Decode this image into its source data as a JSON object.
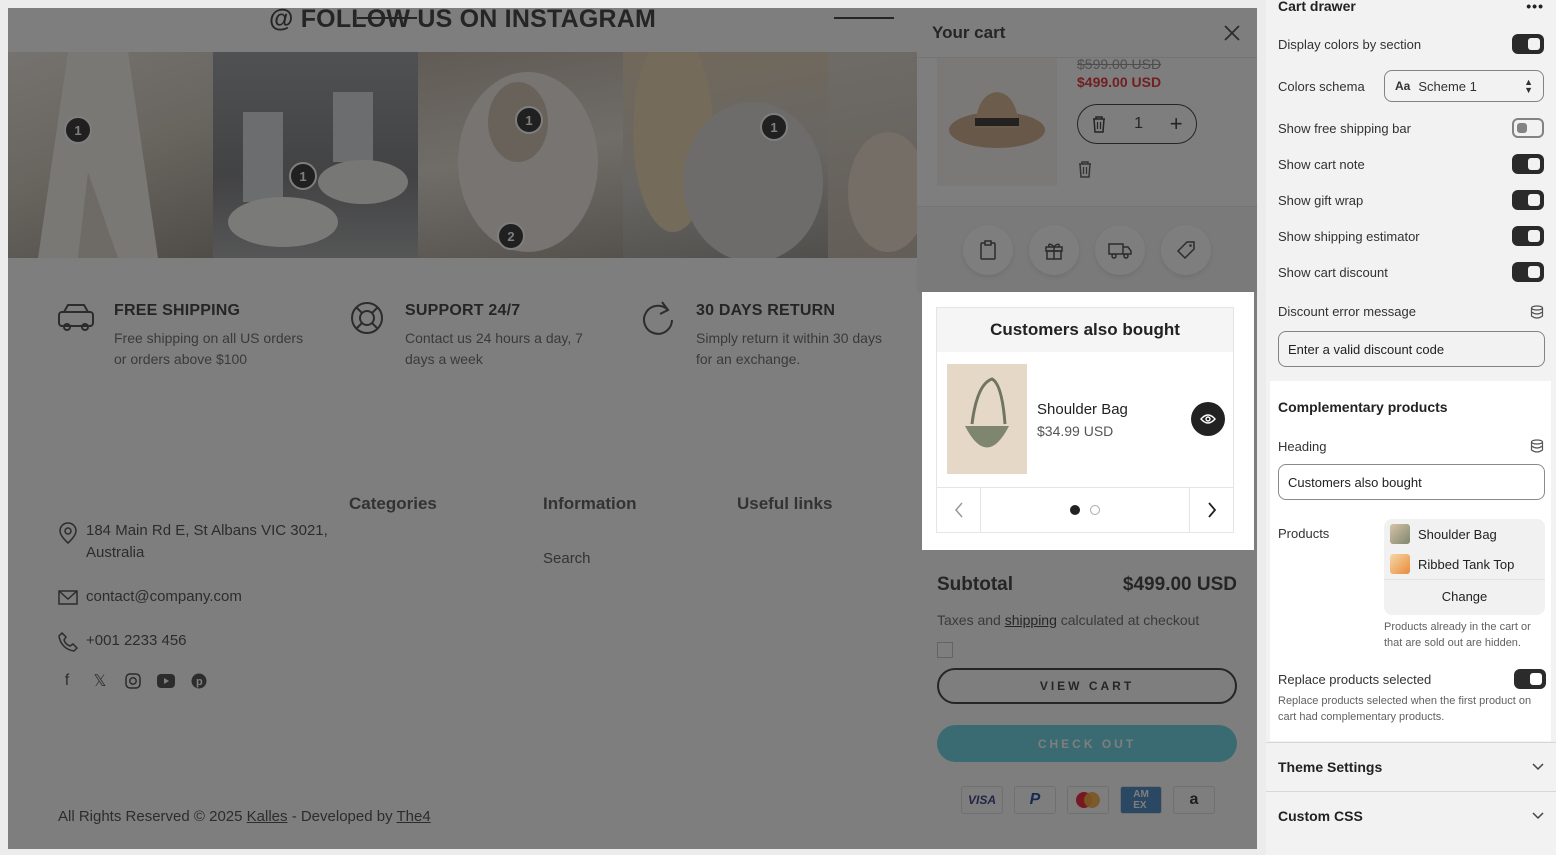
{
  "instagram": {
    "title": "@ FOLLOW US ON INSTAGRAM",
    "pins": [
      "1",
      "1",
      "1",
      "2",
      "1",
      "1"
    ]
  },
  "features": [
    {
      "title": "FREE SHIPPING",
      "text": "Free shipping on all US orders or orders above $100",
      "icon": "truck-icon"
    },
    {
      "title": "SUPPORT 24/7",
      "text": "Contact us 24 hours a day, 7 days a week",
      "icon": "lifebuoy-icon"
    },
    {
      "title": "30 DAYS RETURN",
      "text": "Simply return it within 30 days for an exchange.",
      "icon": "return-icon"
    }
  ],
  "footer": {
    "address": "184 Main Rd E, St Albans VIC 3021, Australia",
    "email": "contact@company.com",
    "phone": "+001 2233 456",
    "columns": [
      "Categories",
      "Information",
      "Useful links"
    ],
    "information_links": [
      "Search"
    ],
    "copyright_prefix": "All Rights Reserved © 2025",
    "brand": "Kalles",
    "dev_prefix": "- Developed by",
    "developer": "The4"
  },
  "cart": {
    "title": "Your cart",
    "item": {
      "old_price": "$599.00 USD",
      "price": "$499.00 USD",
      "qty": "1"
    },
    "also_bought": {
      "heading": "Customers also bought",
      "product_name": "Shoulder Bag",
      "product_price": "$34.99 USD",
      "page": 1,
      "pages": 2
    },
    "subtotal_label": "Subtotal",
    "subtotal_value": "$499.00 USD",
    "tax_prefix": "Taxes and",
    "tax_link": "shipping",
    "tax_suffix": "calculated at checkout",
    "view_cart": "VIEW CART",
    "checkout": "CHECK OUT",
    "payments": [
      "VISA",
      "PayPal",
      "Mastercard",
      "AMEX",
      "amazon"
    ]
  },
  "settings": {
    "section_title": "Cart drawer",
    "rows": [
      {
        "label": "Display colors by section",
        "on": true
      },
      {
        "label": "Show free shipping bar",
        "on": false
      },
      {
        "label": "Show cart note",
        "on": true
      },
      {
        "label": "Show gift wrap",
        "on": true
      },
      {
        "label": "Show shipping estimator",
        "on": true
      },
      {
        "label": "Show cart discount",
        "on": true
      }
    ],
    "color_schema_label": "Colors schema",
    "color_schema_value": "Scheme 1",
    "discount_error_label": "Discount error message",
    "discount_error_value": "Enter a valid discount code",
    "complementary": {
      "title": "Complementary products",
      "heading_label": "Heading",
      "heading_value": "Customers also bought",
      "products_label": "Products",
      "products": [
        "Shoulder Bag",
        "Ribbed Tank Top"
      ],
      "change_label": "Change",
      "products_help": "Products already in the cart or that are sold out are hidden.",
      "replace_label": "Replace products selected",
      "replace_on": true,
      "replace_help": "Replace products selected when the first product on cart had complementary products."
    },
    "theme_settings": "Theme Settings",
    "custom_css": "Custom CSS"
  },
  "colors": {
    "sale_red": "#e0121a",
    "checkout_teal": "#56cfe1",
    "toggle_dark": "#2b2b2b"
  }
}
